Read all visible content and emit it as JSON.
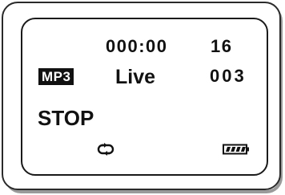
{
  "display": {
    "time": "000:00",
    "track": "16",
    "format_badge": "MP3",
    "eq_mode": "Live",
    "volume": "003",
    "status": "STOP"
  },
  "icons": {
    "repeat": "repeat-icon",
    "battery": "battery-icon"
  },
  "battery": {
    "level": 1.0
  },
  "colors": {
    "lcd_text": "#111111",
    "lcd_background": "#ffffff",
    "shell_shadow": "#9a9a9a"
  }
}
